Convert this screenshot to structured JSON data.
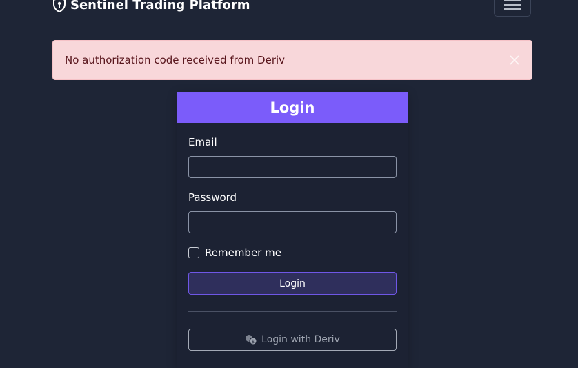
{
  "navbar": {
    "brand_text": "Sentinel Trading Platform",
    "brand_icon": "shield-icon",
    "toggler_icon": "hamburger-menu-icon"
  },
  "alert": {
    "message": "No authorization code received from Deriv",
    "close_icon": "close-icon"
  },
  "login_card": {
    "title": "Login",
    "email_label": "Email",
    "email_value": "",
    "password_label": "Password",
    "password_value": "",
    "remember_label": "Remember me",
    "remember_checked": false,
    "submit_label": "Login",
    "deriv_label": "Login with Deriv",
    "deriv_icon": "coins-icon"
  },
  "colors": {
    "background": "#1e2536",
    "accent": "#7b5cfa",
    "alert_bg": "#f8d7da",
    "alert_text": "#58151c"
  }
}
